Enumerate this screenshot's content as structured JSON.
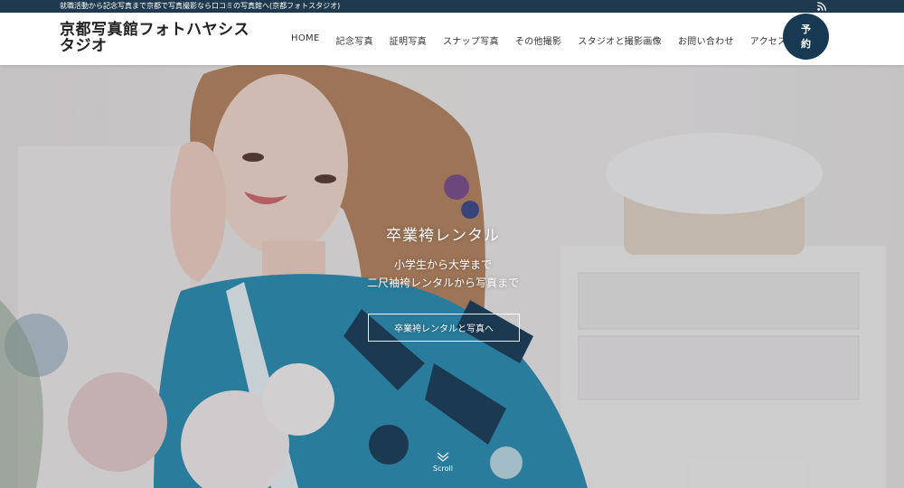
{
  "topbar": {
    "tagline": "就職活動から記念写真まで京都で写真撮影なら口コミの写真館へ(京都フォトスタジオ)",
    "rss_icon": "rss-icon"
  },
  "header": {
    "site_title": "京都写真館フォトハヤシスタジオ",
    "nav": [
      {
        "label": "HOME"
      },
      {
        "label": "記念写真"
      },
      {
        "label": "証明写真"
      },
      {
        "label": "スナップ写真"
      },
      {
        "label": "その他撮影"
      },
      {
        "label": "スタジオと撮影画像"
      },
      {
        "label": "お問い合わせ"
      },
      {
        "label": "アクセス"
      }
    ],
    "reserve_line1": "予",
    "reserve_line2": "約"
  },
  "hero": {
    "title": "卒業袴レンタル",
    "subtitle_line1": "小学生から大学まで",
    "subtitle_line2": "二尺袖袴レンタルから写真まで",
    "button_label": "卒業袴レンタルと写真へ",
    "scroll_label": "Scroll",
    "colors": {
      "kimono_blue": "#2a8fb4",
      "navy": "#1f3a4f",
      "hair": "#b88560"
    }
  }
}
